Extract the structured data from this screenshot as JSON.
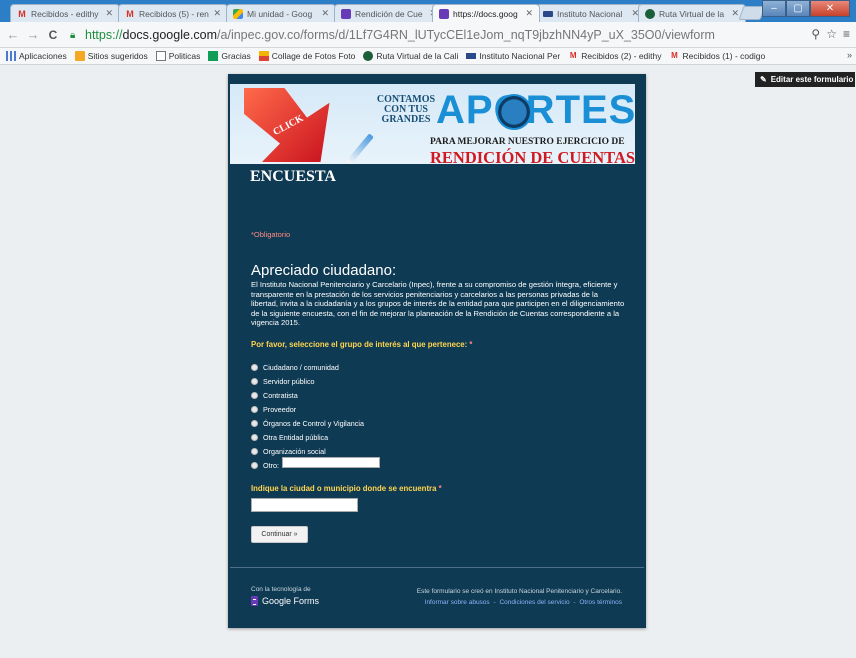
{
  "browser": {
    "tabs": [
      {
        "title": "Recibidos - edithy",
        "icon": "gmail-icon"
      },
      {
        "title": "Recibidos (5) - ren",
        "icon": "gmail-icon"
      },
      {
        "title": "Mi unidad - Goog",
        "icon": "drive-icon"
      },
      {
        "title": "Rendición de Cue",
        "icon": "forms-icon"
      },
      {
        "title": "https://docs.goog",
        "icon": "forms-icon",
        "active": true
      },
      {
        "title": "Instituto Nacional",
        "icon": "institute-icon"
      },
      {
        "title": "Ruta Virtual de la",
        "icon": "ruta-icon"
      }
    ],
    "url": {
      "scheme": "https://",
      "host": "docs.google.com",
      "path": "/a/inpec.gov.co/forms/d/1Lf7G4RN_lUTycCEl1eJom_nqT9jbzhNN4yP_uX_35O0/viewform"
    },
    "bookmarks": [
      {
        "label": "Aplicaciones",
        "icon": "apps-icon"
      },
      {
        "label": "Sitios sugeridos",
        "icon": "suggested-icon"
      },
      {
        "label": "Politicas",
        "icon": "document-icon"
      },
      {
        "label": "Gracias",
        "icon": "sheets-icon"
      },
      {
        "label": "Collage de Fotos Foto",
        "icon": "photo-icon"
      },
      {
        "label": "Ruta Virtual de la Cali",
        "icon": "ruta-icon"
      },
      {
        "label": "Instituto Nacional Per",
        "icon": "institute-icon"
      },
      {
        "label": "Recibidos (2) - edithy",
        "icon": "gmail-icon"
      },
      {
        "label": "Recibidos (1) - codigo",
        "icon": "gmail-icon"
      }
    ],
    "bookmarks_more": "»"
  },
  "page": {
    "edit_button": "Editar este formulario",
    "banner": {
      "click": "CLICK",
      "encuesta": "ENCUESTA",
      "contamos": "CONTAMOS CON TUS GRANDES",
      "aportes": "APORTES",
      "para": "PARA MEJORAR NUESTRO EJERCICIO DE",
      "rendicion": "RENDICIÓN DE CUENTAS"
    },
    "required_note": "*Obligatorio",
    "title": "Apreciado ciudadano:",
    "description": "El Instituto Nacional Penitenciario y Carcelario (Inpec), frente a su compromiso de gestión íntegra, eficiente y transparente en la prestación de los servicios penitenciarios y carcelarios a las personas privadas de la libertad, invita a la ciudadanía y a los grupos de interés de la entidad para que participen en el diligenciamiento de la siguiente encuesta, con el fin de mejorar la planeación de la Rendición de Cuentas correspondiente a la vigencia 2015.",
    "question1": {
      "label": "Por favor, seleccione el grupo de interés al que pertenece:",
      "required_mark": "*",
      "options": [
        "Ciudadano / comunidad",
        "Servidor público",
        "Contratista",
        "Proveedor",
        "Órganos de Control y Vigilancia",
        "Otra Entidad pública",
        "Organización social",
        "Otro:"
      ],
      "other_value": ""
    },
    "question2": {
      "label": "Indique la ciudad o municipio donde se encuentra",
      "required_mark": "*",
      "value": ""
    },
    "continue_button": "Continuar »",
    "footer": {
      "tech": "Con la tecnología de",
      "brand": "Google Forms",
      "created": "Este formulario se creó en Instituto Nacional Penitenciario y Carcelario.",
      "links": [
        "Informar sobre abusos",
        "Condiciones del servicio",
        "Otros términos"
      ],
      "separator": "-"
    }
  }
}
